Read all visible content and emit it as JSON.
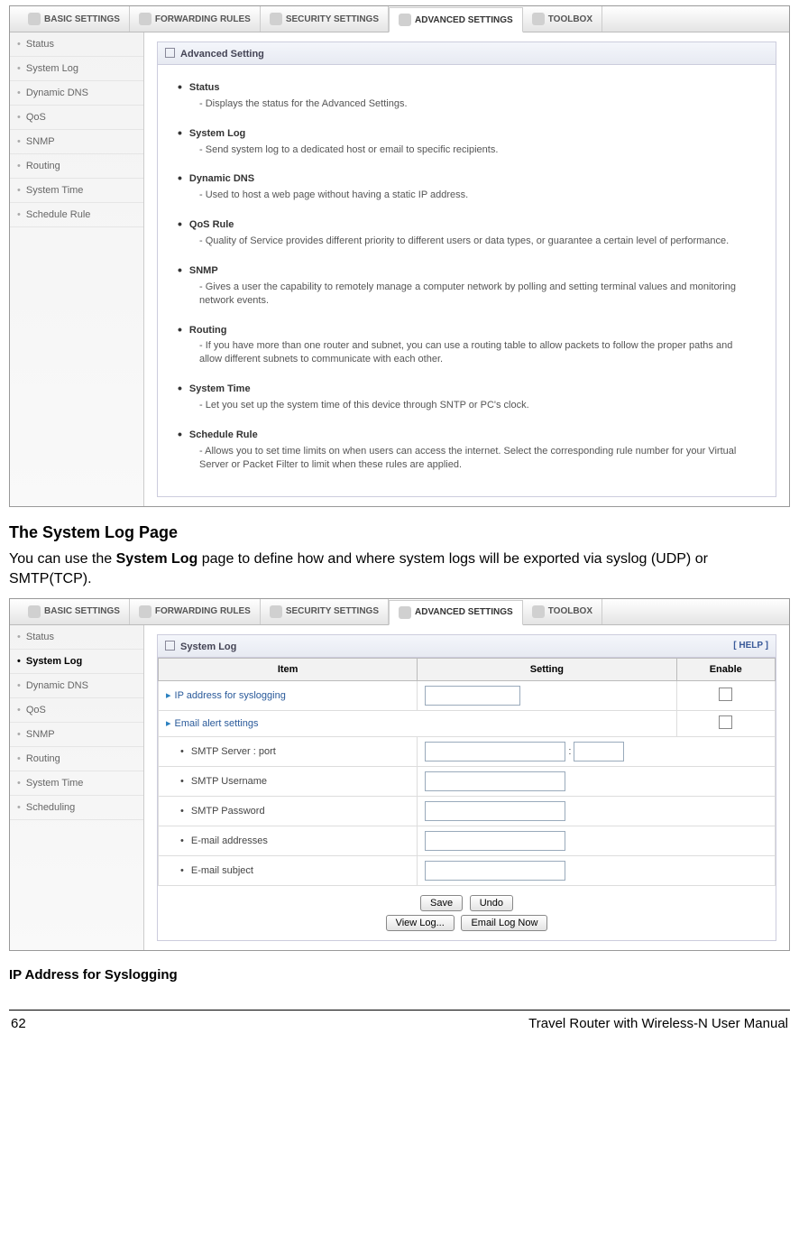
{
  "tabs": {
    "t0": "BASIC SETTINGS",
    "t1": "FORWARDING RULES",
    "t2": "SECURITY SETTINGS",
    "t3": "ADVANCED SETTINGS",
    "t4": "TOOLBOX"
  },
  "shot1": {
    "side": {
      "i0": "Status",
      "i1": "System Log",
      "i2": "Dynamic DNS",
      "i3": "QoS",
      "i4": "SNMP",
      "i5": "Routing",
      "i6": "System Time",
      "i7": "Schedule Rule"
    },
    "title": "Advanced Setting",
    "items": {
      "n0": "Status",
      "d0": "Displays the status for the Advanced Settings.",
      "n1": "System Log",
      "d1": "Send system log to a dedicated host or email to specific recipients.",
      "n2": "Dynamic DNS",
      "d2": "Used to host a web page without having a static IP address.",
      "n3": "QoS Rule",
      "d3": "Quality of Service provides different priority to different users or data types, or guarantee a certain level of performance.",
      "n4": "SNMP",
      "d4": "Gives a user the capability to remotely manage a computer network by polling and setting terminal values and monitoring network events.",
      "n5": "Routing",
      "d5": "If you have more than one router and subnet, you can use a routing table to allow packets to follow the proper paths and allow different subnets to communicate with each other.",
      "n6": "System Time",
      "d6": "Let you set up the system time of this device through SNTP or PC's clock.",
      "n7": "Schedule Rule",
      "d7": "Allows you to set time limits on when users can access the internet. Select the corresponding rule number for your Virtual Server or Packet Filter to limit when these rules are applied."
    }
  },
  "doc": {
    "h": "The System Log Page",
    "p1a": "You can use the ",
    "p1b": "System Log",
    "p1c": " page to define how and where system logs will be exported via syslog (UDP) or SMTP(TCP).",
    "sub": "IP Address for Syslogging"
  },
  "shot2": {
    "side": {
      "i0": "Status",
      "i1": "System Log",
      "i2": "Dynamic DNS",
      "i3": "QoS",
      "i4": "SNMP",
      "i5": "Routing",
      "i6": "System Time",
      "i7": "Scheduling"
    },
    "title": "System Log",
    "help": "[ HELP ]",
    "th": {
      "c0": "Item",
      "c1": "Setting",
      "c2": "Enable"
    },
    "rows": {
      "r0": "IP address for syslogging",
      "r1": "Email alert settings",
      "r2": "SMTP Server : port",
      "r3": "SMTP Username",
      "r4": "SMTP Password",
      "r5": "E-mail addresses",
      "r6": "E-mail subject"
    },
    "btns": {
      "b0": "Save",
      "b1": "Undo",
      "b2": "View Log...",
      "b3": "Email Log Now"
    },
    "colon": ":"
  },
  "footer": {
    "page": "62",
    "title": "Travel Router with Wireless-N User Manual"
  }
}
